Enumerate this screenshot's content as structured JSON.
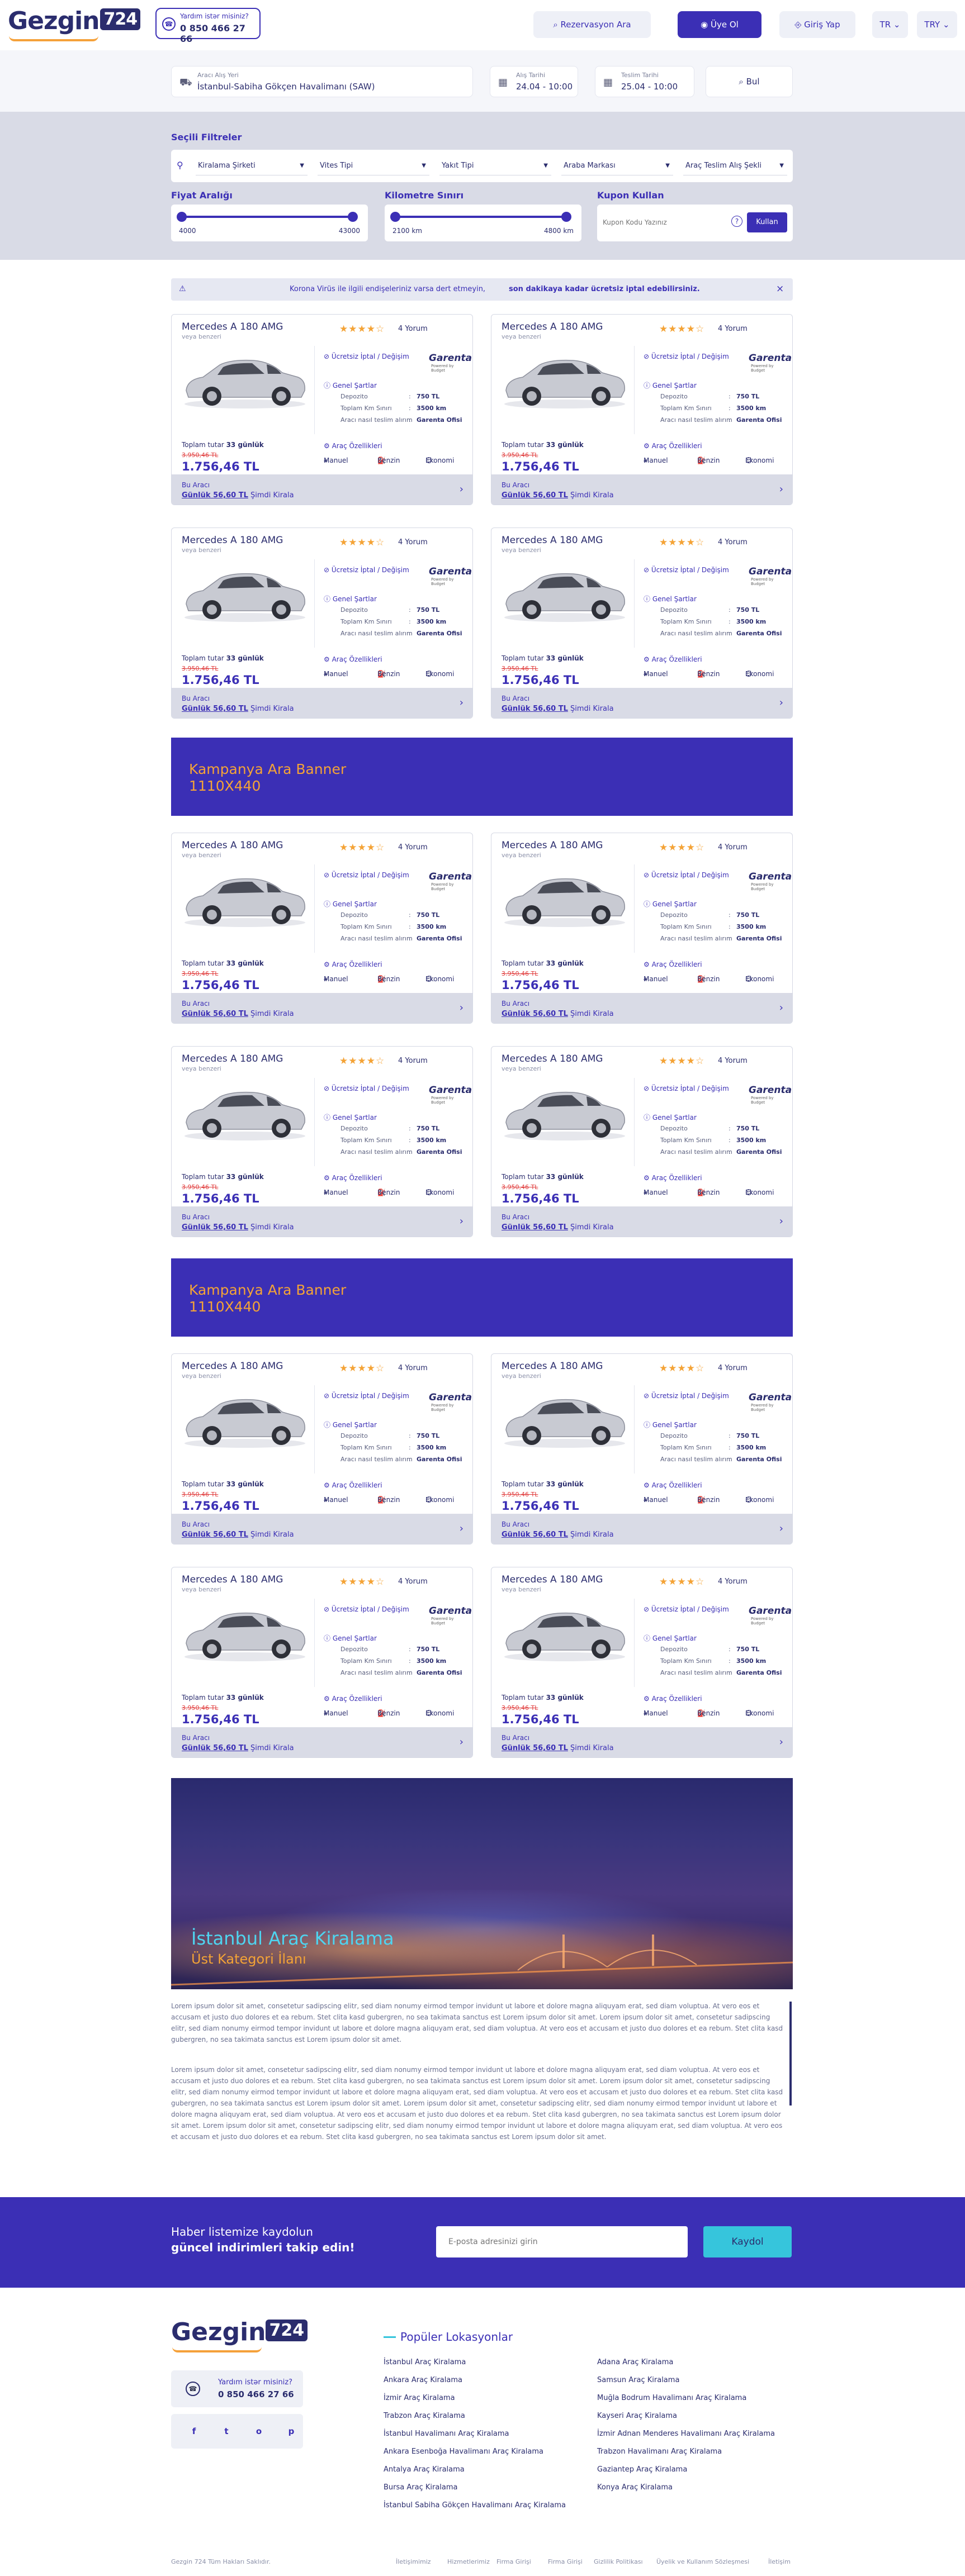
{
  "header": {
    "logo_text": "Gezgin",
    "logo_badge": "724",
    "help_title": "Yardım istər misiniz?",
    "help_phone": "0 850 466 27 66",
    "reservation_button": "Rezervasyon Ara",
    "member_button": "Üye Ol",
    "login_button": "Giriş Yap",
    "language": "TR",
    "currency": "TRY"
  },
  "search": {
    "pickup_label": "Aracı Alış Yeri",
    "pickup_value": "İstanbul-Sabiha Gökçen Havalimanı (SAW)",
    "pickup_date_label": "Alış Tarihi",
    "pickup_date_value": "24.04 - 10:00",
    "return_date_label": "Teslim Tarihi",
    "return_date_value": "25.04 - 10:00",
    "search_button": "Bul"
  },
  "filters": {
    "title": "Seçili Filtreler",
    "selects": [
      "Kiralama Şirketi",
      "Vites Tipi",
      "Yakıt Tipi",
      "Araba Markası",
      "Araç Teslim Alış Şekli"
    ],
    "price_title": "Fiyat Aralığı",
    "price_min": "4000",
    "price_max": "43000",
    "km_title": "Kilometre Sınırı",
    "km_min": "2100 km",
    "km_max": "4800 km",
    "coupon_title": "Kupon Kullan",
    "coupon_placeholder": "Kupon Kodu Yazınız",
    "coupon_button": "Kullan"
  },
  "notice": {
    "text": "Korona Virüs ile ilgili endişeleriniz varsa dert etmeyin,",
    "bold": "son dakikaya kadar ücretsiz iptal edebilirsiniz.",
    "close": "×"
  },
  "card": {
    "name": "Mercedes A 180 AMG",
    "sub": "veya benzeri",
    "stars": "★★★★☆",
    "reviews": "4 Yorum",
    "cancel": "Ücretsiz İptal / Değişim",
    "company": "Garenta",
    "company_sub": "Powered by Budget",
    "conditions_title": "Genel Şartlar",
    "conditions": [
      {
        "k": "Depozito",
        "v": "750 TL"
      },
      {
        "k": "Toplam Km Sınırı",
        "v": "3500 km"
      },
      {
        "k": "Aracı nasıl teslim alırım",
        "v": "Garenta Ofisi"
      }
    ],
    "features_title": "Araç Özellikleri",
    "features": [
      "Manuel",
      "Benzin",
      "Ekonomi"
    ],
    "total_label": "Toplam tutar",
    "total_days": "33 günlük",
    "old_price": "3.950,46 TL",
    "price": "1.756,46 TL",
    "footer_label": "Bu Aracı",
    "daily_label": "Günlük",
    "daily_price": "56,60 TL",
    "rent_now": "Şimdi Kirala"
  },
  "banner": {
    "line1": "Kampanya Ara Banner",
    "line2": "1110X440"
  },
  "city": {
    "title": "İstanbul Araç Kiralama",
    "subtitle": "Üst Kategori İlanı"
  },
  "paragraph1": "Lorem ipsum dolor sit amet, consetetur sadipscing elitr, sed diam nonumy eirmod tempor invidunt ut labore et dolore magna aliquyam erat, sed diam voluptua. At vero eos et accusam et justo duo dolores et ea rebum. Stet clita kasd gubergren, no sea takimata sanctus est Lorem ipsum dolor sit amet. Lorem ipsum dolor sit amet, consetetur sadipscing elitr, sed diam nonumy eirmod tempor invidunt ut labore et dolore magna aliquyam erat, sed diam voluptua. At vero eos et accusam et justo duo dolores et ea rebum. Stet clita kasd gubergren, no sea takimata sanctus est Lorem ipsum dolor sit amet.",
  "paragraph2": "Lorem ipsum dolor sit amet, consetetur sadipscing elitr, sed diam nonumy eirmod tempor invidunt ut labore et dolore magna aliquyam erat, sed diam voluptua. At vero eos et accusam et justo duo dolores et ea rebum. Stet clita kasd gubergren, no sea takimata sanctus est Lorem ipsum dolor sit amet. Lorem ipsum dolor sit amet, consetetur sadipscing elitr, sed diam nonumy eirmod tempor invidunt ut labore et dolore magna aliquyam erat, sed diam voluptua. At vero eos et accusam et justo duo dolores et ea rebum. Stet clita kasd gubergren, no sea takimata sanctus est Lorem ipsum dolor sit amet. Lorem ipsum dolor sit amet, consetetur sadipscing elitr, sed diam nonumy eirmod tempor invidunt ut labore et dolore magna aliquyam erat, sed diam voluptua. At vero eos et accusam et justo duo dolores et ea rebum. Stet clita kasd gubergren, no sea takimata sanctus est Lorem ipsum dolor sit amet. Lorem ipsum dolor sit amet, consetetur sadipscing elitr, sed diam nonumy eirmod tempor invidunt ut labore et dolore magna aliquyam erat, sed diam voluptua. At vero eos et accusam et justo duo dolores et ea rebum. Stet clita kasd gubergren, no sea takimata sanctus est Lorem ipsum dolor sit amet.",
  "newsletter": {
    "line1": "Haber listemize kaydolun",
    "line2": "güncel indirimleri takip edin!",
    "placeholder": "E-posta adresinizi girin",
    "button": "Kaydol"
  },
  "footer": {
    "help_title": "Yardım istər misiniz?",
    "help_phone": "0 850 466 27 66",
    "social": [
      "f",
      "t",
      "o",
      "p"
    ],
    "popular_title": "Popüler Lokasyonlar",
    "locations_left": [
      "İstanbul Araç Kiralama",
      "Ankara Araç Kiralama",
      "İzmir Araç Kiralama",
      "Trabzon Araç Kiralama",
      "İstanbul Havalimanı Araç Kiralama",
      "Ankara Esenboğa Havalimanı Araç Kiralama",
      "Antalya Araç Kiralama",
      "Bursa Araç Kiralama",
      "İstanbul Sabiha Gökçen Havalimanı Araç Kiralama"
    ],
    "locations_right": [
      "Adana Araç Kiralama",
      "Samsun Araç Kiralama",
      "Muğla Bodrum Havalimanı Araç Kiralama",
      "Kayseri Araç Kiralama",
      "İzmir Adnan Menderes Havalimanı Araç Kiralama",
      "Trabzon Havalimanı Araç Kiralama",
      "Gaziantep Araç Kiralama",
      "Konya Araç Kiralama"
    ],
    "copyright": "Gezgin 724 Tüm Hakları Saklıdır.",
    "links": [
      "İletişimimiz",
      "Hizmetlerimiz",
      "Firma Girişi",
      "Firma Girişi",
      "Gizlilik Politikası",
      "Üyelik ve Kullanım Sözleşmesi",
      "İletişim"
    ]
  }
}
